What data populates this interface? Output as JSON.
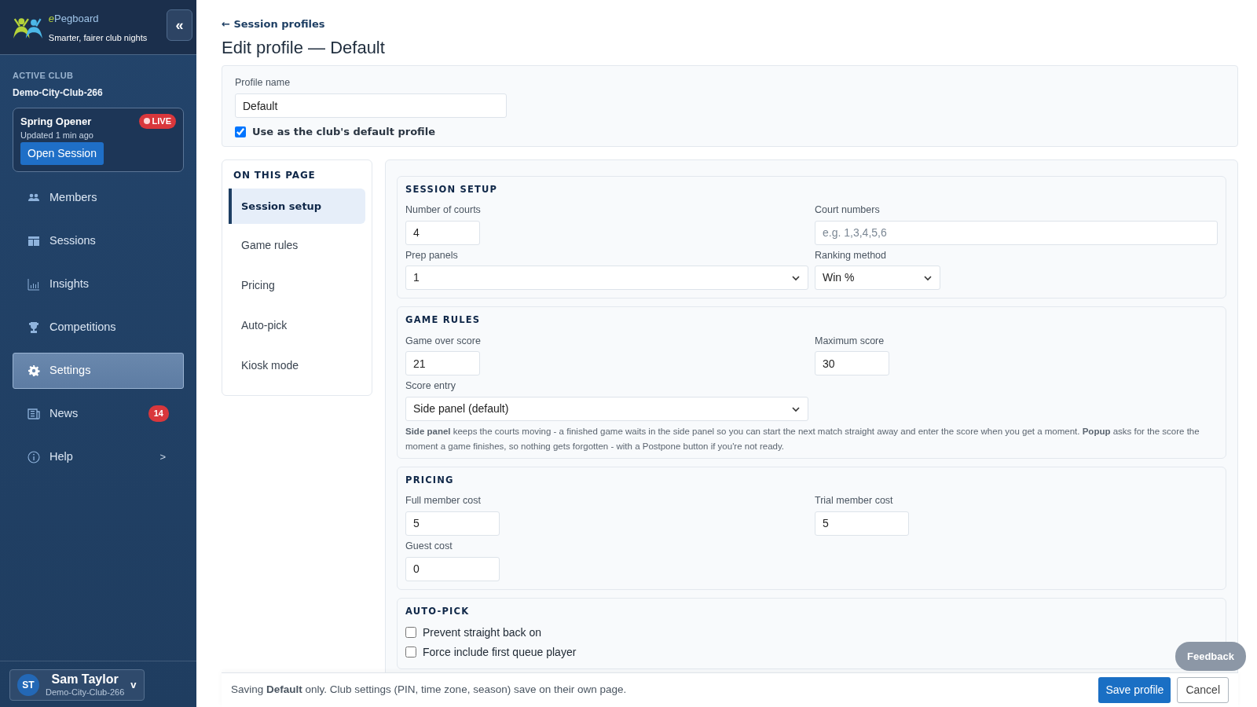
{
  "sidebar": {
    "brand": {
      "prefix": "e",
      "name": "Pegboard",
      "tagline": "Smarter, fairer club nights"
    },
    "collapse_button": "«",
    "active_club": {
      "label": "ACTIVE CLUB",
      "name": "Demo-City-Club-266"
    },
    "session_card": {
      "title": "Spring Opener",
      "badge": "LIVE",
      "updated": "Updated 1 min ago",
      "button": "Open Session"
    },
    "nav": [
      {
        "label": "Members",
        "selected": false
      },
      {
        "label": "Sessions",
        "selected": false
      },
      {
        "label": "Insights",
        "selected": false
      },
      {
        "label": "Competitions",
        "selected": false
      },
      {
        "label": "Settings",
        "selected": true
      },
      {
        "label": "News",
        "selected": false,
        "badge": "14"
      },
      {
        "label": "Help",
        "selected": false,
        "chevron": ">"
      }
    ],
    "user": {
      "initials": "ST",
      "name": "Sam Taylor",
      "club": "Demo-City-Club-266",
      "caret": "v"
    }
  },
  "main": {
    "back_link": "← Session profiles",
    "title": "Edit profile — Default",
    "profile": {
      "label": "Profile name",
      "value": "Default",
      "default_checkbox": {
        "label": "Use as the club's default profile",
        "checked": true
      }
    },
    "on_this_page": {
      "title": "ON THIS PAGE",
      "items": [
        {
          "label": "Session setup",
          "selected": true
        },
        {
          "label": "Game rules",
          "selected": false
        },
        {
          "label": "Pricing",
          "selected": false
        },
        {
          "label": "Auto-pick",
          "selected": false
        },
        {
          "label": "Kiosk mode",
          "selected": false
        }
      ]
    },
    "sections": [
      {
        "title": "SESSION SETUP",
        "rows": [
          [
            {
              "kind": "number",
              "label": "Number of courts",
              "value": "4"
            },
            {
              "kind": "text",
              "label": "Court numbers",
              "placeholder": "e.g. 1,3,4,5,6"
            }
          ],
          [
            {
              "kind": "select",
              "label": "Prep panels",
              "value": "1"
            },
            {
              "kind": "select_compact",
              "label": "Ranking method",
              "value": "Win %"
            }
          ]
        ]
      },
      {
        "title": "GAME RULES",
        "rows": [
          [
            {
              "kind": "number",
              "label": "Game over score",
              "value": "21"
            },
            {
              "kind": "number",
              "label": "Maximum score",
              "value": "30"
            }
          ],
          [
            {
              "kind": "select",
              "label": "Score entry",
              "value": "Side panel (default)"
            }
          ]
        ],
        "note": "**Side panel** keeps the courts moving - a finished game waits in the side panel so you can start the next match straight away and enter the score when you get a moment. **Popup** asks for the score the moment a game finishes, so nothing gets forgotten - with a Postpone button if you're not ready."
      },
      {
        "title": "PRICING",
        "rows": [
          [
            {
              "kind": "cost",
              "label": "Full member cost",
              "value": "5"
            },
            {
              "kind": "cost",
              "label": "Trial member cost",
              "value": "5"
            }
          ],
          [
            {
              "kind": "cost",
              "label": "Guest cost",
              "value": "0"
            }
          ]
        ]
      },
      {
        "title": "AUTO-PICK",
        "rows": [
          [
            {
              "kind": "checkbox",
              "label": "Prevent straight back on",
              "checked": false
            }
          ],
          [
            {
              "kind": "checkbox",
              "label": "Force include first queue player",
              "checked": false
            }
          ]
        ]
      }
    ]
  },
  "footer": {
    "message": "Saving **Default** only. Club settings (PIN, time zone, season) save on their own page.",
    "save_button": "Save profile",
    "cancel_button": "Cancel"
  },
  "feedback_button": "Feedback"
}
